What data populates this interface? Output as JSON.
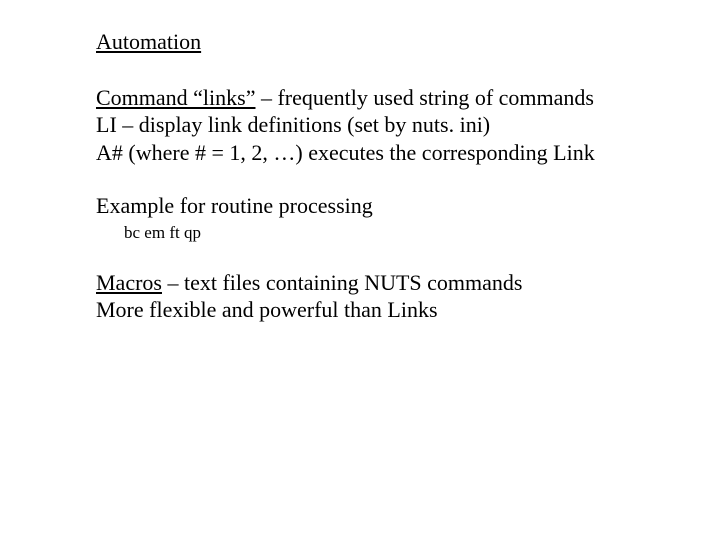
{
  "heading": "Automation",
  "block1": {
    "line1_underlined": "Command “links”",
    "line1_rest": " – frequently used string of commands",
    "line2": "LI – display link definitions (set by nuts. ini)",
    "line3": "A# (where # = 1, 2, …) executes the corresponding Link"
  },
  "example": {
    "label": "Example for routine processing",
    "code": "bc em ft qp"
  },
  "block2": {
    "line1_underlined": "Macros",
    "line1_rest": " – text files containing NUTS commands",
    "line2": "More flexible and powerful than Links"
  }
}
